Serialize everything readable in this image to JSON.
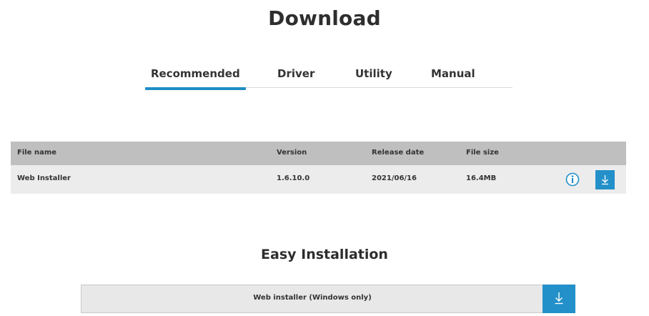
{
  "page": {
    "title": "Download"
  },
  "tabs": [
    {
      "label": "Recommended",
      "active": true
    },
    {
      "label": "Driver",
      "active": false
    },
    {
      "label": "Utility",
      "active": false
    },
    {
      "label": "Manual",
      "active": false
    }
  ],
  "table": {
    "headers": {
      "file_name": "File name",
      "version": "Version",
      "release_date": "Release date",
      "file_size": "File size"
    },
    "rows": [
      {
        "file_name": "Web Installer",
        "version": "1.6.10.0",
        "release_date": "2021/06/16",
        "file_size": "16.4MB",
        "info_icon": "info-icon",
        "download_icon": "download-arrow-icon"
      }
    ]
  },
  "easy_installation": {
    "title": "Easy Installation",
    "button_label": "Web installer (Windows only)",
    "icon": "download-arrow-icon"
  },
  "colors": {
    "accent": "#2390c9",
    "table_header_bg": "#bfbfbf",
    "table_row_bg": "#ececec"
  }
}
